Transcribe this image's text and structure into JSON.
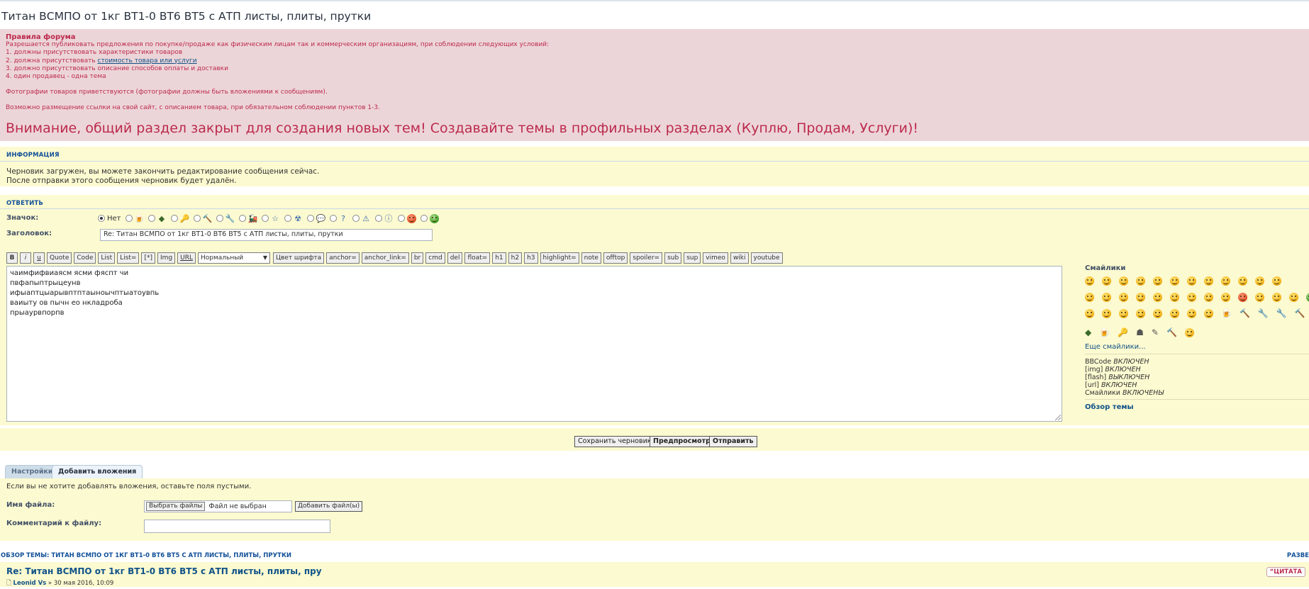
{
  "page": {
    "title": "Титан ВСМПО от 1кг ВТ1-0 ВТ6 ВТ5 с АТП листы, плиты, прутки"
  },
  "rules": {
    "title": "Правила форума",
    "line1": "Разрешается публиковать предложения по покупке/продаже как физическим лицам так и коммерческим организациям, при соблюдении следующих условий:",
    "item1": "1. должны присутствовать характеристики товаров",
    "item2_prefix": "2. должна присутствовать ",
    "item2_link": "стоимость товара или услуги",
    "item3": "3. должно присутствовать описание способов оплаты и доставки",
    "item4": "4. один продавец - одна тема",
    "photos": "Фотографии товаров приветствуются (фотографии должны быть вложениями к сообщениям).",
    "links": "Возможно размещение ссылки на свой сайт, с описанием товара, при обязательном соблюдении пунктов 1-3.",
    "warning": "Внимание, общий раздел закрыт для создания новых тем! Создавайте темы в профильных разделах (Куплю, Продам, Услуги)!"
  },
  "info": {
    "heading": "Информация",
    "line1": "Черновик загружен, вы можете закончить редактирование сообщения сейчас.",
    "line2": "После отправки этого сообщения черновик будет удалён."
  },
  "reply": {
    "heading": "Ответить",
    "icon_label": "Значок:",
    "icon_none": "Нет",
    "subject_label": "Заголовок:",
    "subject_value": "Re: Титан ВСМПО от 1кг ВТ1-0 ВТ6 ВТ5 с АТП листы, плиты, прутки"
  },
  "toolbar": {
    "bold": "B",
    "italic": "i",
    "underline": "u",
    "buttons_a": [
      "Quote",
      "Code",
      "List",
      "List=",
      "[*]",
      "Img",
      "URL"
    ],
    "font_size": "Нормальный",
    "buttons_b": [
      "Цвет шрифта",
      "anchor=",
      "anchor_link=",
      "br",
      "cmd",
      "del",
      "float=",
      "h1",
      "h2",
      "h3",
      "highlight=",
      "note",
      "offtop",
      "spoiler=",
      "sub",
      "sup",
      "vimeo",
      "wiki",
      "youtube"
    ]
  },
  "editor": {
    "lines": [
      "чаимфифвиаясм ясми фяспт чи",
      "пвфапыптрыцеунв",
      "ифыаптцыарывптптаыноычптыатоувпь",
      "ваиыту ов пычн ео нкладроба",
      "прыаурвпорпв"
    ]
  },
  "sidebar": {
    "smileys_title": "Смайлики",
    "more_smileys": "Еще смайлики...",
    "bbcode": "BBCode",
    "bbcode_state": "ВКЛЮЧЕН",
    "img": "[img]",
    "img_state": "ВКЛЮЧЕН",
    "flash": "[flash]",
    "flash_state": "ВЫКЛЮЧЕН",
    "url": "[url]",
    "url_state": "ВКЛЮЧЕН",
    "smileys": "Смайлики",
    "smileys_state": "ВКЛЮЧЕНЫ",
    "topic_review": "Обзор темы"
  },
  "submit": {
    "save_draft": "Сохранить черновик",
    "preview": "Предпросмотр",
    "send": "Отправить"
  },
  "tabs": {
    "settings": "Настройки",
    "attachments": "Добавить вложения"
  },
  "attachments": {
    "note": "Если вы не хотите добавлять вложения, оставьте поля пустыми.",
    "filename_label": "Имя файла:",
    "choose_files": "Выбрать файлы",
    "no_file": "Файл не выбран",
    "add_file": "Добавить файл(ы)",
    "comment_label": "Комментарий к файлу:"
  },
  "review": {
    "heading": "Обзор темы: Титан ВСМПО от 1кг ВТ1-0 ВТ6 ВТ5 с АТП листы, плиты, прутки",
    "expand": "РАЗВЕ",
    "post_title": "Re: Титан ВСМПО от 1кг ВТ1-0 ВТ6 ВТ5 с АТП листы, плиты, пру",
    "author": "Leonid Vs",
    "date": "» 30 мая 2016, 10:09",
    "quote": "ЦИТАТА"
  }
}
